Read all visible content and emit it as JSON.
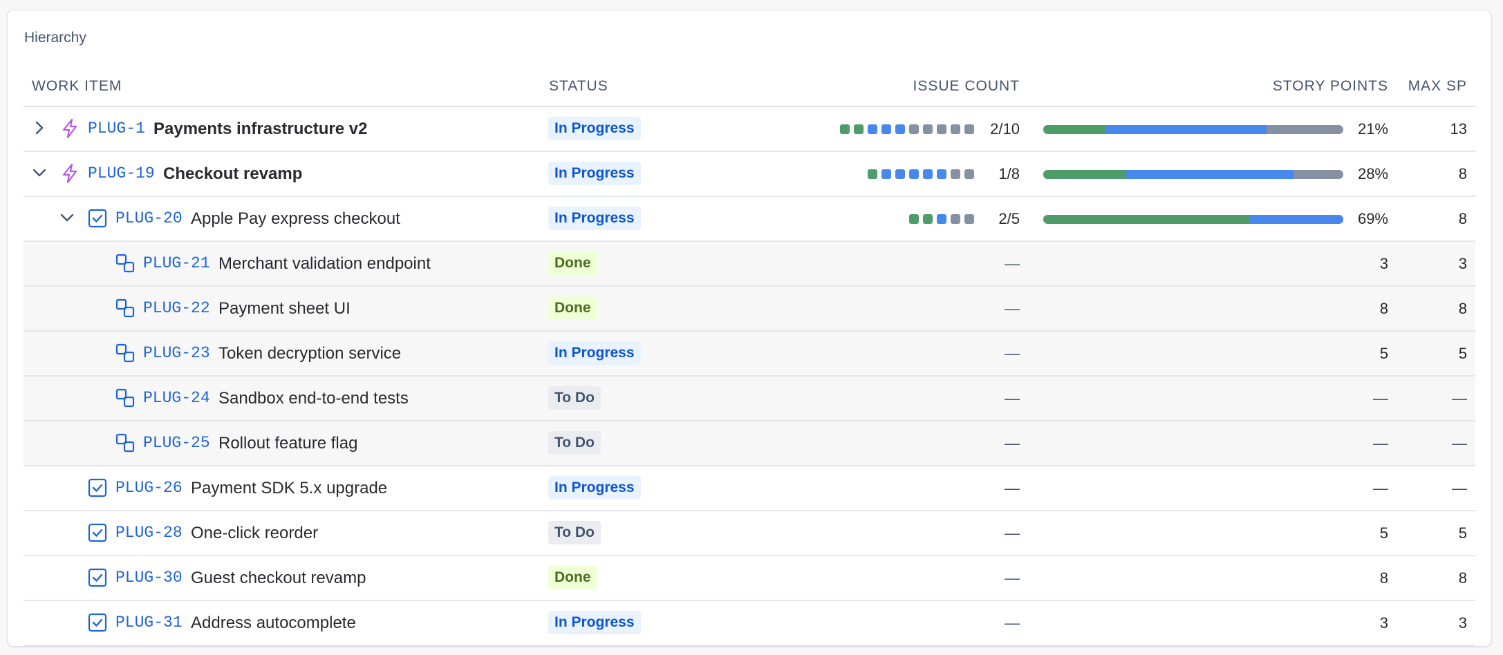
{
  "panel": {
    "title": "Hierarchy"
  },
  "columns": {
    "work_item": "WORK ITEM",
    "status": "STATUS",
    "issue_count": "ISSUE COUNT",
    "story_points": "STORY POINTS",
    "max_sp": "MAX SP"
  },
  "colors": {
    "done": "#4f9c6b",
    "in_progress": "#4688ec",
    "todo": "#8590a2",
    "key_link": "#1d64d8",
    "epic_icon": "#b658e6"
  },
  "rows": [
    {
      "key": "PLUG-1",
      "summary": "Payments infrastructure v2",
      "type": "epic",
      "level": 0,
      "chevron": "right",
      "status": "In Progress",
      "status_kind": "inprogress",
      "issue_count": "2/10",
      "count_dots": [
        "done",
        "done",
        "inprogress",
        "inprogress",
        "inprogress",
        "todo",
        "todo",
        "todo",
        "todo",
        "todo"
      ],
      "progress": {
        "done": 0.205,
        "in_progress": 0.54
      },
      "story_points": "21%",
      "max_sp": "13"
    },
    {
      "key": "PLUG-19",
      "summary": "Checkout revamp",
      "type": "epic",
      "level": 0,
      "chevron": "down",
      "status": "In Progress",
      "status_kind": "inprogress",
      "issue_count": "1/8",
      "count_dots": [
        "done",
        "inprogress",
        "inprogress",
        "inprogress",
        "inprogress",
        "inprogress",
        "todo",
        "todo"
      ],
      "progress": {
        "done": 0.275,
        "in_progress": 0.56
      },
      "story_points": "28%",
      "max_sp": "8"
    },
    {
      "key": "PLUG-20",
      "summary": "Apple Pay express checkout",
      "type": "task",
      "level": 1,
      "chevron": "down",
      "status": "In Progress",
      "status_kind": "inprogress",
      "issue_count": "2/5",
      "count_dots": [
        "done",
        "done",
        "inprogress",
        "todo",
        "todo"
      ],
      "progress": {
        "done": 0.69,
        "in_progress": 0.31
      },
      "story_points": "69%",
      "max_sp": "8"
    },
    {
      "key": "PLUG-21",
      "summary": "Merchant validation endpoint",
      "type": "subtask",
      "level": 2,
      "status": "Done",
      "status_kind": "done",
      "issue_count": "—",
      "story_points": "3",
      "max_sp": "3"
    },
    {
      "key": "PLUG-22",
      "summary": "Payment sheet UI",
      "type": "subtask",
      "level": 2,
      "status": "Done",
      "status_kind": "done",
      "issue_count": "—",
      "story_points": "8",
      "max_sp": "8"
    },
    {
      "key": "PLUG-23",
      "summary": "Token decryption service",
      "type": "subtask",
      "level": 2,
      "status": "In Progress",
      "status_kind": "inprogress",
      "issue_count": "—",
      "story_points": "5",
      "max_sp": "5"
    },
    {
      "key": "PLUG-24",
      "summary": "Sandbox end-to-end tests",
      "type": "subtask",
      "level": 2,
      "status": "To Do",
      "status_kind": "todo",
      "issue_count": "—",
      "story_points": "—",
      "max_sp": "—"
    },
    {
      "key": "PLUG-25",
      "summary": "Rollout feature flag",
      "type": "subtask",
      "level": 2,
      "status": "To Do",
      "status_kind": "todo",
      "issue_count": "—",
      "story_points": "—",
      "max_sp": "—"
    },
    {
      "key": "PLUG-26",
      "summary": "Payment SDK 5.x upgrade",
      "type": "task",
      "level": 1,
      "status": "In Progress",
      "status_kind": "inprogress",
      "issue_count": "—",
      "story_points": "—",
      "max_sp": "—"
    },
    {
      "key": "PLUG-28",
      "summary": "One-click reorder",
      "type": "task",
      "level": 1,
      "status": "To Do",
      "status_kind": "todo",
      "issue_count": "—",
      "story_points": "5",
      "max_sp": "5"
    },
    {
      "key": "PLUG-30",
      "summary": "Guest checkout revamp",
      "type": "task",
      "level": 1,
      "status": "Done",
      "status_kind": "done",
      "issue_count": "—",
      "story_points": "8",
      "max_sp": "8"
    },
    {
      "key": "PLUG-31",
      "summary": "Address autocomplete",
      "type": "task",
      "level": 1,
      "status": "In Progress",
      "status_kind": "inprogress",
      "issue_count": "—",
      "story_points": "3",
      "max_sp": "3"
    }
  ]
}
